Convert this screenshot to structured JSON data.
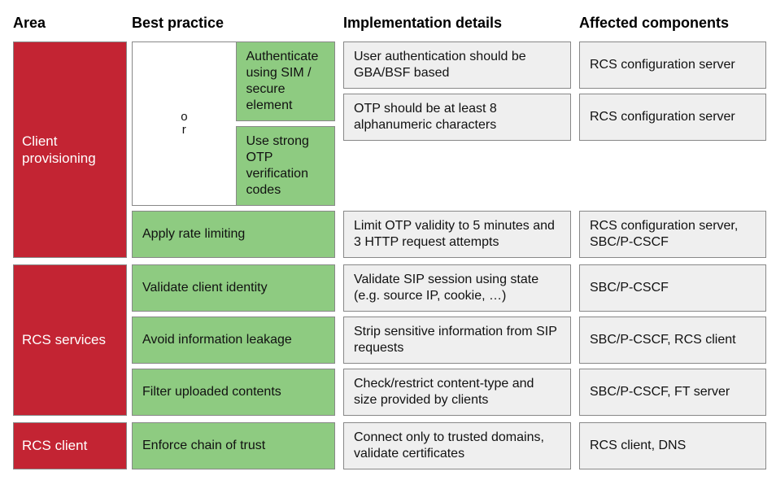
{
  "headers": {
    "area": "Area",
    "best_practice": "Best practice",
    "implementation": "Implementation details",
    "affected": "Affected components"
  },
  "sections": [
    {
      "area": "Client provisioning",
      "group_or": "or",
      "group_rows": [
        {
          "bp": "Authenticate using SIM / secure element",
          "impl": "User authentication should be GBA/BSF based",
          "aff": "RCS configuration server"
        },
        {
          "bp": "Use strong OTP verification codes",
          "impl": "OTP should be at least 8 alphanumeric characters",
          "aff": "RCS configuration server"
        }
      ],
      "tail_rows": [
        {
          "bp": "Apply rate limiting",
          "impl": "Limit OTP validity to 5 minutes and 3 HTTP request attempts",
          "aff": "RCS configuration server, SBC/P-CSCF"
        }
      ]
    },
    {
      "area": "RCS services",
      "rows": [
        {
          "bp": "Validate client identity",
          "impl": "Validate SIP session using state (e.g. source IP, cookie, …)",
          "aff": "SBC/P-CSCF"
        },
        {
          "bp": "Avoid information leakage",
          "impl": "Strip sensitive information from SIP requests",
          "aff": "SBC/P-CSCF, RCS client"
        },
        {
          "bp": "Filter uploaded contents",
          "impl": "Check/restrict content-type and size provided by clients",
          "aff": "SBC/P-CSCF, FT server"
        }
      ]
    },
    {
      "area": "RCS client",
      "rows": [
        {
          "bp": "Enforce chain of trust",
          "impl": "Connect only to trusted domains, validate certificates",
          "aff": "RCS client, DNS"
        }
      ]
    }
  ],
  "colors": {
    "area_bg": "#c32433",
    "bp_bg": "#8ecb81",
    "cell_bg": "#efefef"
  }
}
